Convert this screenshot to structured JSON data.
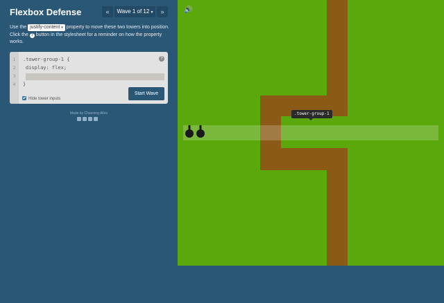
{
  "header": {
    "title": "Flexbox Defense",
    "prev_label": "«",
    "next_label": "»",
    "wave_label": "Wave 1 of 12",
    "wave_caret": "▾"
  },
  "instructions": {
    "part1": "Use the ",
    "keyword": "justify-content",
    "keyword_caret": "▾",
    "part2": " property to move these two towers into position. Click the ",
    "help_glyph": "?",
    "part3": " button in the stylesheet for a reminder on how the property works."
  },
  "editor": {
    "line_numbers": [
      "1",
      "2",
      "3",
      "4"
    ],
    "lines": [
      ".tower-group-1 {",
      "  display: flex;",
      "",
      "}"
    ],
    "input_value": "",
    "help_label": "?",
    "hide_inputs_label": "Hide tower inputs",
    "start_button": "Start Wave"
  },
  "credit": "Made by Channing Allen",
  "social_icons": [
    "facebook-icon",
    "twitter-icon",
    "linkedin-icon",
    "github-icon"
  ],
  "board": {
    "speaker_icon": "🔊",
    "tooltip": ".tower-group-1"
  },
  "colors": {
    "sidebar_bg": "#2b5776",
    "board_green": "#5aa80c",
    "path_brown": "#8b5a16",
    "editor_bg": "#e2e2e2"
  }
}
